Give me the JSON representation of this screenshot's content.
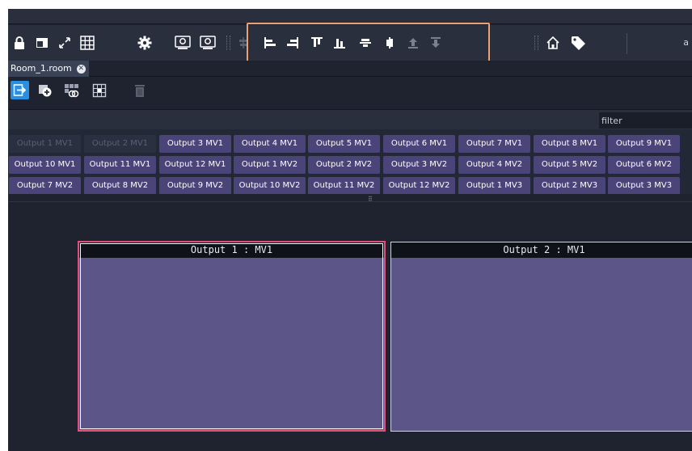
{
  "toolbar": {
    "left_icons": [
      "lock-icon",
      "window-icon",
      "fullscreen-icon",
      "grid-icon",
      "gear-icon",
      "camera-monitor-icon",
      "camera-monitor-edit-icon"
    ],
    "align_icons": [
      "align-center-vertical-icon",
      "align-left-icon",
      "align-right-icon",
      "align-top-icon",
      "align-bottom-icon",
      "align-middle-horizontal-icon",
      "align-center-icon",
      "bring-to-front-icon",
      "send-to-back-icon"
    ],
    "right_icons": [
      "home-icon",
      "tag-icon"
    ],
    "user_label": "a"
  },
  "tabs": [
    {
      "label": "Room_1.room",
      "close_icon": "close-icon"
    }
  ],
  "subtoolbar": {
    "icons": [
      "enter-icon",
      "add-layout-icon",
      "link-layout-icon",
      "grid-snap-icon",
      "trash-icon"
    ]
  },
  "filter": {
    "placeholder": "filter"
  },
  "outputs": {
    "row1": [
      {
        "label": "Output 1 MV1",
        "disabled": true
      },
      {
        "label": "Output 2 MV1",
        "disabled": true
      },
      {
        "label": "Output 3 MV1",
        "disabled": false
      },
      {
        "label": "Output 4 MV1",
        "disabled": false
      },
      {
        "label": "Output 5 MV1",
        "disabled": false
      },
      {
        "label": "Output 6 MV1",
        "disabled": false
      },
      {
        "label": "Output 7 MV1",
        "disabled": false
      },
      {
        "label": "Output 8 MV1",
        "disabled": false
      },
      {
        "label": "Output 9 MV1",
        "disabled": false
      }
    ],
    "row2": [
      {
        "label": "Output 10 MV1",
        "disabled": false
      },
      {
        "label": "Output 11 MV1",
        "disabled": false
      },
      {
        "label": "Output 12 MV1",
        "disabled": false
      },
      {
        "label": "Output 1 MV2",
        "disabled": false
      },
      {
        "label": "Output 2 MV2",
        "disabled": false
      },
      {
        "label": "Output 3 MV2",
        "disabled": false
      },
      {
        "label": "Output 4 MV2",
        "disabled": false
      },
      {
        "label": "Output 5 MV2",
        "disabled": false
      },
      {
        "label": "Output 6 MV2",
        "disabled": false
      }
    ],
    "row3": [
      {
        "label": "Output 7 MV2",
        "disabled": false
      },
      {
        "label": "Output 8 MV2",
        "disabled": false
      },
      {
        "label": "Output 9 MV2",
        "disabled": false
      },
      {
        "label": "Output 10 MV2",
        "disabled": false
      },
      {
        "label": "Output 11 MV2",
        "disabled": false
      },
      {
        "label": "Output 12 MV2",
        "disabled": false
      },
      {
        "label": "Output 1 MV3",
        "disabled": false
      },
      {
        "label": "Output 2 MV3",
        "disabled": false
      },
      {
        "label": "Output 3 MV3",
        "disabled": false
      }
    ]
  },
  "viewers": [
    {
      "title": "Output 1 : MV1",
      "selected": true
    },
    {
      "title": "Output 2 : MV1",
      "selected": false
    }
  ],
  "colors": {
    "background": "#1f2330",
    "toolbar": "#2a2f3d",
    "output_button": "#4a4478",
    "viewer_fill": "#5c5587",
    "selected_border": "#e0507a",
    "highlight_box": "#f0a070",
    "active_button": "#2b8ee0"
  }
}
